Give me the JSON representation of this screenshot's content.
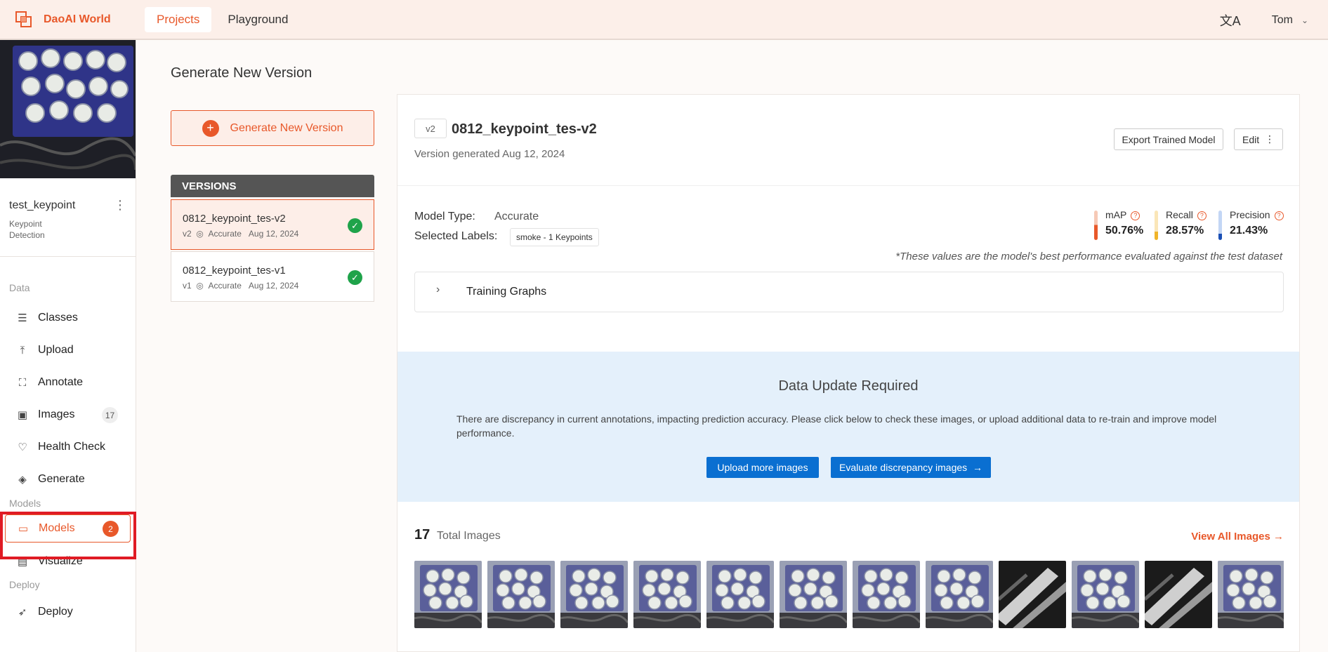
{
  "app": {
    "name": "DaoAI World",
    "user": "Tom"
  },
  "nav": {
    "tabs": [
      {
        "label": "Projects"
      },
      {
        "label": "Playground"
      }
    ]
  },
  "project": {
    "name": "test_keypoint",
    "type": "Keypoint Detection"
  },
  "sidebar": {
    "data_section": "Data",
    "models_section": "Models",
    "deploy_section": "Deploy",
    "items": [
      {
        "label": "Classes",
        "icon": "list-icon"
      },
      {
        "label": "Upload",
        "icon": "upload-icon"
      },
      {
        "label": "Annotate",
        "icon": "annotate-icon"
      },
      {
        "label": "Images",
        "icon": "images-icon",
        "badge": "17"
      },
      {
        "label": "Health Check",
        "icon": "heart-pulse-icon"
      },
      {
        "label": "Generate",
        "icon": "layers-icon"
      },
      {
        "label": "Models",
        "icon": "folder-icon",
        "badge": "2"
      },
      {
        "label": "Visualize",
        "icon": "document-icon"
      },
      {
        "label": "Deploy",
        "icon": "rocket-icon"
      }
    ]
  },
  "page": {
    "title": "Generate New Version",
    "generate_button": "Generate New Version",
    "versions_header": "VERSIONS"
  },
  "versions": [
    {
      "name": "0812_keypoint_tes-v2",
      "tag": "v2",
      "type": "Accurate",
      "date": "Aug 12, 2024"
    },
    {
      "name": "0812_keypoint_tes-v1",
      "tag": "v1",
      "type": "Accurate",
      "date": "Aug 12, 2024"
    }
  ],
  "detail": {
    "tag": "v2",
    "title": "0812_keypoint_tes-v2",
    "generated": "Version generated Aug 12, 2024",
    "export_button": "Export Trained Model",
    "edit_button": "Edit",
    "model_type_label": "Model Type:",
    "model_type": "Accurate",
    "selected_labels_label": "Selected Labels:",
    "selected_label_chip": "smoke - 1 Keypoints",
    "metrics": [
      {
        "name": "mAP",
        "value": "50.76%",
        "fraction": 0.5076,
        "color": "#e8582a",
        "track": "#f6c9b6"
      },
      {
        "name": "Recall",
        "value": "28.57%",
        "fraction": 0.2857,
        "color": "#f0b429",
        "track": "#fae6b8"
      },
      {
        "name": "Precision",
        "value": "21.43%",
        "fraction": 0.2143,
        "color": "#1a4fb5",
        "track": "#c3d6f5"
      }
    ],
    "perf_note": "*These values are the model's best performance evaluated against the test dataset",
    "training_graphs": "Training Graphs"
  },
  "update": {
    "title": "Data Update Required",
    "text": "There are discrepancy in current annotations, impacting prediction accuracy. Please click below to check these images, or upload additional data to re-train and improve model performance.",
    "upload_button": "Upload more images",
    "evaluate_button": "Evaluate discrepancy images"
  },
  "images": {
    "count": "17",
    "label": "Total Images",
    "view_all": "View All Images",
    "thumbnails": [
      "plates",
      "plates",
      "plates",
      "plates",
      "plates",
      "plates",
      "plates",
      "plates",
      "dark",
      "plates",
      "dark",
      "plates"
    ]
  }
}
